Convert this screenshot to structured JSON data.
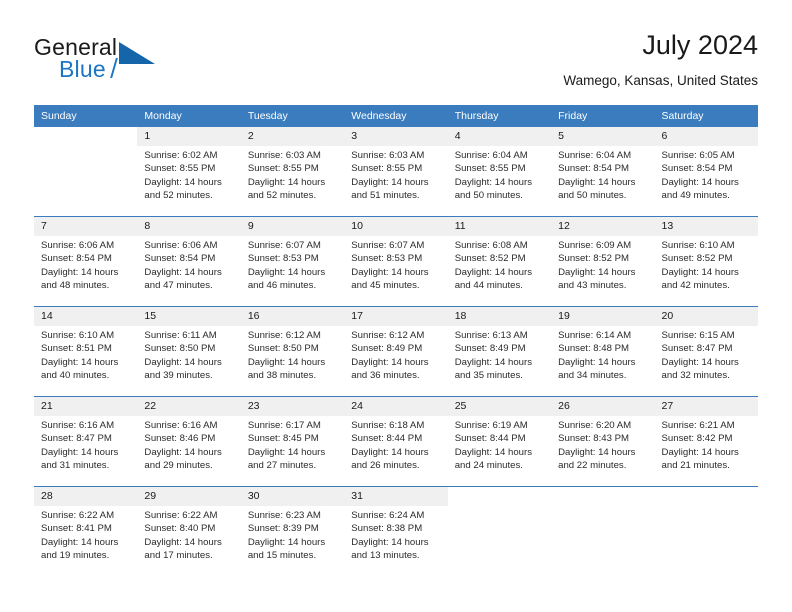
{
  "brand": {
    "name_part1": "General",
    "name_part2": "Blue",
    "logo_icon": "triangle-flag-icon"
  },
  "header": {
    "title": "July 2024",
    "subtitle": "Wamego, Kansas, United States"
  },
  "colors": {
    "header_blue": "#3a7cbe",
    "brand_blue": "#1c76c4",
    "daynum_bg": "#f0f0f0",
    "text": "#1a1a1a"
  },
  "weekdays": [
    "Sunday",
    "Monday",
    "Tuesday",
    "Wednesday",
    "Thursday",
    "Friday",
    "Saturday"
  ],
  "weeks": [
    [
      {
        "day": "",
        "sunrise": "",
        "sunset": "",
        "daylight_line1": "",
        "daylight_line2": ""
      },
      {
        "day": "1",
        "sunrise": "Sunrise: 6:02 AM",
        "sunset": "Sunset: 8:55 PM",
        "daylight_line1": "Daylight: 14 hours",
        "daylight_line2": "and 52 minutes."
      },
      {
        "day": "2",
        "sunrise": "Sunrise: 6:03 AM",
        "sunset": "Sunset: 8:55 PM",
        "daylight_line1": "Daylight: 14 hours",
        "daylight_line2": "and 52 minutes."
      },
      {
        "day": "3",
        "sunrise": "Sunrise: 6:03 AM",
        "sunset": "Sunset: 8:55 PM",
        "daylight_line1": "Daylight: 14 hours",
        "daylight_line2": "and 51 minutes."
      },
      {
        "day": "4",
        "sunrise": "Sunrise: 6:04 AM",
        "sunset": "Sunset: 8:55 PM",
        "daylight_line1": "Daylight: 14 hours",
        "daylight_line2": "and 50 minutes."
      },
      {
        "day": "5",
        "sunrise": "Sunrise: 6:04 AM",
        "sunset": "Sunset: 8:54 PM",
        "daylight_line1": "Daylight: 14 hours",
        "daylight_line2": "and 50 minutes."
      },
      {
        "day": "6",
        "sunrise": "Sunrise: 6:05 AM",
        "sunset": "Sunset: 8:54 PM",
        "daylight_line1": "Daylight: 14 hours",
        "daylight_line2": "and 49 minutes."
      }
    ],
    [
      {
        "day": "7",
        "sunrise": "Sunrise: 6:06 AM",
        "sunset": "Sunset: 8:54 PM",
        "daylight_line1": "Daylight: 14 hours",
        "daylight_line2": "and 48 minutes."
      },
      {
        "day": "8",
        "sunrise": "Sunrise: 6:06 AM",
        "sunset": "Sunset: 8:54 PM",
        "daylight_line1": "Daylight: 14 hours",
        "daylight_line2": "and 47 minutes."
      },
      {
        "day": "9",
        "sunrise": "Sunrise: 6:07 AM",
        "sunset": "Sunset: 8:53 PM",
        "daylight_line1": "Daylight: 14 hours",
        "daylight_line2": "and 46 minutes."
      },
      {
        "day": "10",
        "sunrise": "Sunrise: 6:07 AM",
        "sunset": "Sunset: 8:53 PM",
        "daylight_line1": "Daylight: 14 hours",
        "daylight_line2": "and 45 minutes."
      },
      {
        "day": "11",
        "sunrise": "Sunrise: 6:08 AM",
        "sunset": "Sunset: 8:52 PM",
        "daylight_line1": "Daylight: 14 hours",
        "daylight_line2": "and 44 minutes."
      },
      {
        "day": "12",
        "sunrise": "Sunrise: 6:09 AM",
        "sunset": "Sunset: 8:52 PM",
        "daylight_line1": "Daylight: 14 hours",
        "daylight_line2": "and 43 minutes."
      },
      {
        "day": "13",
        "sunrise": "Sunrise: 6:10 AM",
        "sunset": "Sunset: 8:52 PM",
        "daylight_line1": "Daylight: 14 hours",
        "daylight_line2": "and 42 minutes."
      }
    ],
    [
      {
        "day": "14",
        "sunrise": "Sunrise: 6:10 AM",
        "sunset": "Sunset: 8:51 PM",
        "daylight_line1": "Daylight: 14 hours",
        "daylight_line2": "and 40 minutes."
      },
      {
        "day": "15",
        "sunrise": "Sunrise: 6:11 AM",
        "sunset": "Sunset: 8:50 PM",
        "daylight_line1": "Daylight: 14 hours",
        "daylight_line2": "and 39 minutes."
      },
      {
        "day": "16",
        "sunrise": "Sunrise: 6:12 AM",
        "sunset": "Sunset: 8:50 PM",
        "daylight_line1": "Daylight: 14 hours",
        "daylight_line2": "and 38 minutes."
      },
      {
        "day": "17",
        "sunrise": "Sunrise: 6:12 AM",
        "sunset": "Sunset: 8:49 PM",
        "daylight_line1": "Daylight: 14 hours",
        "daylight_line2": "and 36 minutes."
      },
      {
        "day": "18",
        "sunrise": "Sunrise: 6:13 AM",
        "sunset": "Sunset: 8:49 PM",
        "daylight_line1": "Daylight: 14 hours",
        "daylight_line2": "and 35 minutes."
      },
      {
        "day": "19",
        "sunrise": "Sunrise: 6:14 AM",
        "sunset": "Sunset: 8:48 PM",
        "daylight_line1": "Daylight: 14 hours",
        "daylight_line2": "and 34 minutes."
      },
      {
        "day": "20",
        "sunrise": "Sunrise: 6:15 AM",
        "sunset": "Sunset: 8:47 PM",
        "daylight_line1": "Daylight: 14 hours",
        "daylight_line2": "and 32 minutes."
      }
    ],
    [
      {
        "day": "21",
        "sunrise": "Sunrise: 6:16 AM",
        "sunset": "Sunset: 8:47 PM",
        "daylight_line1": "Daylight: 14 hours",
        "daylight_line2": "and 31 minutes."
      },
      {
        "day": "22",
        "sunrise": "Sunrise: 6:16 AM",
        "sunset": "Sunset: 8:46 PM",
        "daylight_line1": "Daylight: 14 hours",
        "daylight_line2": "and 29 minutes."
      },
      {
        "day": "23",
        "sunrise": "Sunrise: 6:17 AM",
        "sunset": "Sunset: 8:45 PM",
        "daylight_line1": "Daylight: 14 hours",
        "daylight_line2": "and 27 minutes."
      },
      {
        "day": "24",
        "sunrise": "Sunrise: 6:18 AM",
        "sunset": "Sunset: 8:44 PM",
        "daylight_line1": "Daylight: 14 hours",
        "daylight_line2": "and 26 minutes."
      },
      {
        "day": "25",
        "sunrise": "Sunrise: 6:19 AM",
        "sunset": "Sunset: 8:44 PM",
        "daylight_line1": "Daylight: 14 hours",
        "daylight_line2": "and 24 minutes."
      },
      {
        "day": "26",
        "sunrise": "Sunrise: 6:20 AM",
        "sunset": "Sunset: 8:43 PM",
        "daylight_line1": "Daylight: 14 hours",
        "daylight_line2": "and 22 minutes."
      },
      {
        "day": "27",
        "sunrise": "Sunrise: 6:21 AM",
        "sunset": "Sunset: 8:42 PM",
        "daylight_line1": "Daylight: 14 hours",
        "daylight_line2": "and 21 minutes."
      }
    ],
    [
      {
        "day": "28",
        "sunrise": "Sunrise: 6:22 AM",
        "sunset": "Sunset: 8:41 PM",
        "daylight_line1": "Daylight: 14 hours",
        "daylight_line2": "and 19 minutes."
      },
      {
        "day": "29",
        "sunrise": "Sunrise: 6:22 AM",
        "sunset": "Sunset: 8:40 PM",
        "daylight_line1": "Daylight: 14 hours",
        "daylight_line2": "and 17 minutes."
      },
      {
        "day": "30",
        "sunrise": "Sunrise: 6:23 AM",
        "sunset": "Sunset: 8:39 PM",
        "daylight_line1": "Daylight: 14 hours",
        "daylight_line2": "and 15 minutes."
      },
      {
        "day": "31",
        "sunrise": "Sunrise: 6:24 AM",
        "sunset": "Sunset: 8:38 PM",
        "daylight_line1": "Daylight: 14 hours",
        "daylight_line2": "and 13 minutes."
      },
      {
        "day": "",
        "sunrise": "",
        "sunset": "",
        "daylight_line1": "",
        "daylight_line2": ""
      },
      {
        "day": "",
        "sunrise": "",
        "sunset": "",
        "daylight_line1": "",
        "daylight_line2": ""
      },
      {
        "day": "",
        "sunrise": "",
        "sunset": "",
        "daylight_line1": "",
        "daylight_line2": ""
      }
    ]
  ]
}
